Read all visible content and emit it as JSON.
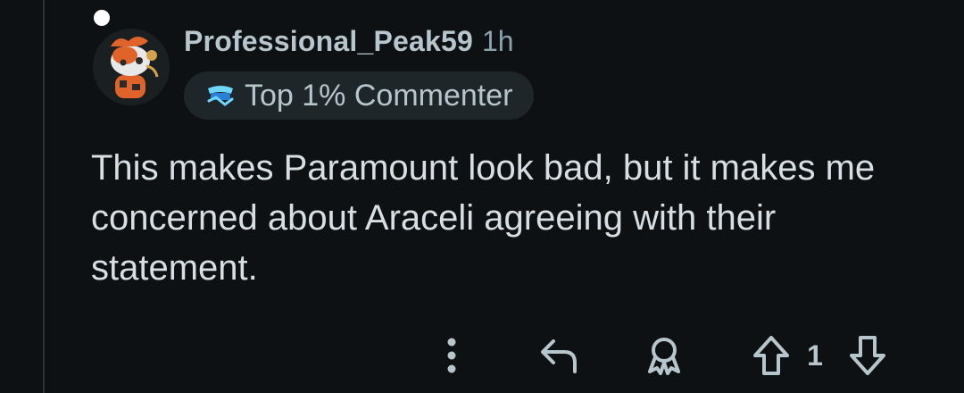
{
  "comment": {
    "username": "Professional_Peak59",
    "timestamp": "1h",
    "flair": {
      "label": "Top 1% Commenter",
      "icon": "top-commenter-badge-icon",
      "icon_color": "#6fd6ff"
    },
    "body": "This makes Paramount look bad, but it makes me concerned about Araceli agreeing with their statement.",
    "avatar": {
      "icon": "snoo-avatar",
      "accent_color": "#e0642a"
    }
  },
  "actions": {
    "more_icon": "more-vertical-icon",
    "reply_icon": "reply-icon",
    "award_icon": "award-icon",
    "upvote_icon": "upvote-arrow-icon",
    "downvote_icon": "downvote-arrow-icon",
    "vote_count": "1"
  },
  "colors": {
    "background": "#0e1113",
    "text_primary": "#d7dfe4",
    "text_secondary": "#b7c5cc",
    "icon": "#b7c5cc"
  }
}
